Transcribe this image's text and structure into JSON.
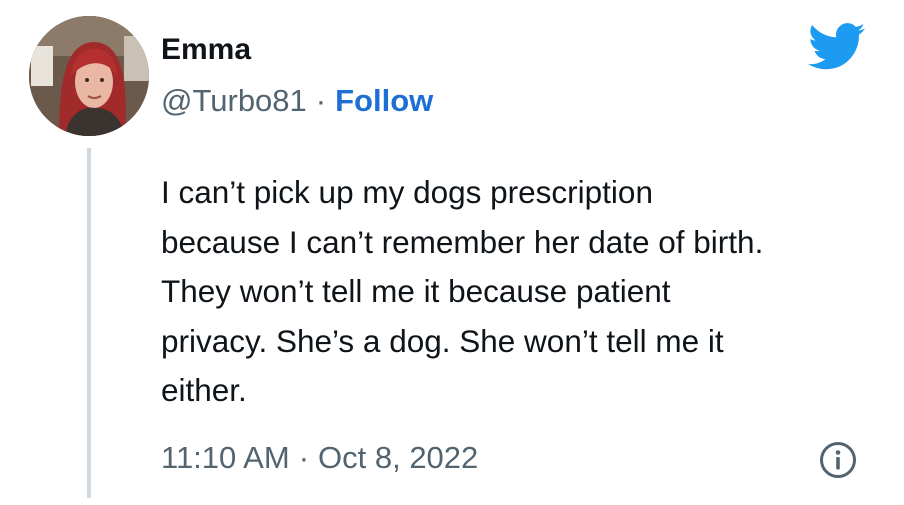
{
  "tweet": {
    "author": {
      "display_name": "Emma",
      "handle": "@Turbo81",
      "separator": "·",
      "follow_label": "Follow"
    },
    "body_lines": [
      "I can’t pick up my dogs prescription",
      "because I can’t remember her date of birth.",
      "They won’t tell me it because patient",
      "privacy. She’s a dog. She won’t tell me it",
      "either."
    ],
    "time": "11:10 AM",
    "meta_separator": "·",
    "date": "Oct 8, 2022"
  },
  "icons": {
    "brand": "twitter-bird-icon",
    "info": "info-circle-icon"
  },
  "colors": {
    "brand_blue": "#1d9bf0",
    "follow_blue": "#1d6fd6",
    "muted_text": "#536471",
    "primary_text": "#0f1419",
    "thread_line": "#cfd9de"
  }
}
